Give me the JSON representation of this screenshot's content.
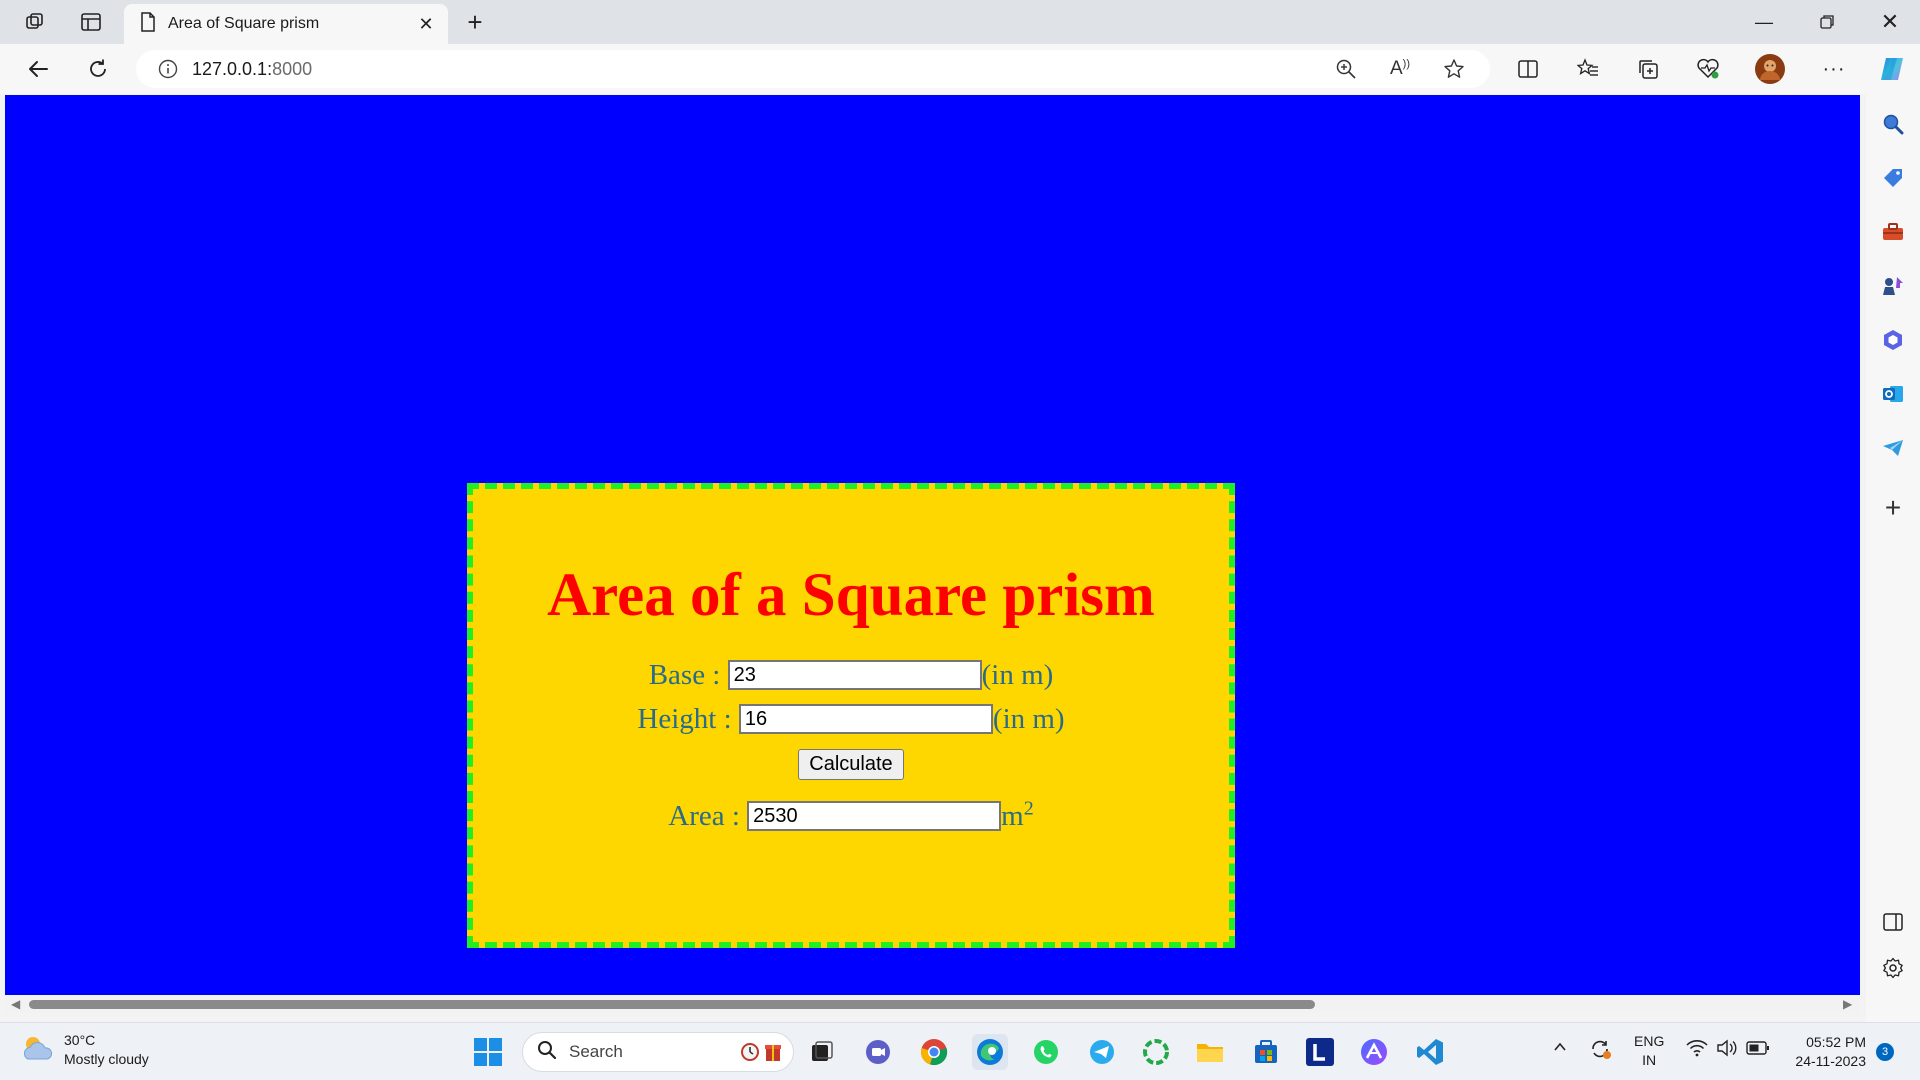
{
  "browser": {
    "tab_title": "Area of Square prism",
    "url_host": "127.0.0.1:",
    "url_port": "8000"
  },
  "page": {
    "background_color": "#0000ff",
    "card_color": "#ffd700",
    "border_color": "#22ee22",
    "heading": "Area of a Square prism",
    "base_label": "Base :",
    "base_value": "23",
    "base_unit": "(in m)",
    "height_label": "Height :",
    "height_value": "16",
    "height_unit": "(in m)",
    "calculate_label": "Calculate",
    "area_label": "Area :",
    "area_value": "2530",
    "area_unit": "m",
    "area_unit_exponent": "2"
  },
  "taskbar": {
    "temperature": "30°C",
    "weather_desc": "Mostly cloudy",
    "search_label": "Search",
    "lang_top": "ENG",
    "lang_bottom": "IN",
    "time": "05:52 PM",
    "date": "24-11-2023",
    "notification_count": "3"
  },
  "icons": {
    "tabbar": [
      "workspaces-icon",
      "tab-actions-icon",
      "page-icon",
      "close-icon",
      "plus-icon",
      "minimize-icon",
      "restore-icon",
      "close-window-icon"
    ],
    "navbar": [
      "back-icon",
      "refresh-icon",
      "info-icon",
      "zoom-icon",
      "read-aloud-icon",
      "favorite-star-icon",
      "split-screen-icon",
      "favorites-icon",
      "collections-icon",
      "performance-icon",
      "profile-avatar",
      "more-icon",
      "copilot-icon"
    ],
    "sidebar": [
      "search-icon",
      "shopping-tag-icon",
      "tools-icon",
      "games-icon",
      "m365-icon",
      "outlook-icon",
      "telegram-icon",
      "add-icon",
      "sidebar-toggle-icon",
      "settings-icon"
    ]
  }
}
